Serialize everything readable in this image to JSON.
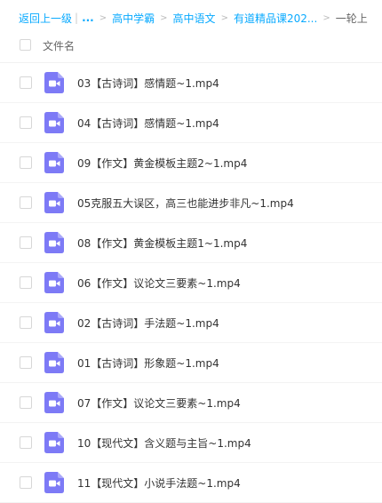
{
  "breadcrumb": {
    "back": "返回上一级",
    "pipe": "|",
    "ellipsis": "...",
    "separator": ">",
    "crumbs": [
      "高中学霸",
      "高中语文",
      "有道精品课202..."
    ],
    "current": "一轮上"
  },
  "list_header": {
    "column_label": "文件名"
  },
  "colors": {
    "link": "#09aaff",
    "video_icon": "#7d7af6"
  },
  "files": [
    {
      "name": "03【古诗词】感情题~1.mp4",
      "icon": "video-file-icon"
    },
    {
      "name": "04【古诗词】感情题~1.mp4",
      "icon": "video-file-icon"
    },
    {
      "name": "09【作文】黄金模板主题2~1.mp4",
      "icon": "video-file-icon"
    },
    {
      "name": "05克服五大误区，高三也能进步非凡~1.mp4",
      "icon": "video-file-icon"
    },
    {
      "name": "08【作文】黄金模板主题1~1.mp4",
      "icon": "video-file-icon"
    },
    {
      "name": "06【作文】议论文三要素~1.mp4",
      "icon": "video-file-icon"
    },
    {
      "name": "02【古诗词】手法题~1.mp4",
      "icon": "video-file-icon"
    },
    {
      "name": "01【古诗词】形象题~1.mp4",
      "icon": "video-file-icon"
    },
    {
      "name": "07【作文】议论文三要素~1.mp4",
      "icon": "video-file-icon"
    },
    {
      "name": "10【现代文】含义题与主旨~1.mp4",
      "icon": "video-file-icon"
    },
    {
      "name": "11【现代文】小说手法题~1.mp4",
      "icon": "video-file-icon"
    }
  ]
}
